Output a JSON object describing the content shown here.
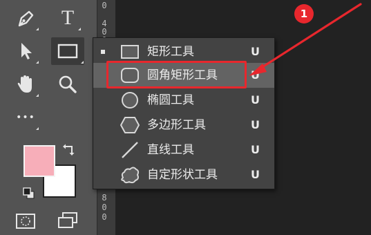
{
  "app": "photoshop",
  "toolbar": {
    "tools": [
      {
        "name": "pen-icon"
      },
      {
        "name": "type-icon",
        "glyph": "T"
      },
      {
        "name": "move-arrow-icon"
      },
      {
        "name": "rectangle-tool-icon",
        "selected": true
      },
      {
        "name": "hand-icon"
      },
      {
        "name": "zoom-icon"
      },
      {
        "name": "more-tools-icon",
        "glyph": "•••"
      }
    ],
    "foreground_color": "#f7aeb9",
    "background_color": "#ffffff"
  },
  "ruler": {
    "top_numbers": [
      "0",
      "4",
      "0",
      "0"
    ],
    "bottom_numbers": [
      "8",
      "0",
      "0"
    ]
  },
  "flyout": {
    "items": [
      {
        "label": "矩形工具",
        "shortcut": "U",
        "icon": "rectangle-icon",
        "active": true
      },
      {
        "label": "圆角矩形工具",
        "shortcut": "U",
        "icon": "rounded-rectangle-icon",
        "hover": true
      },
      {
        "label": "椭圆工具",
        "shortcut": "U",
        "icon": "ellipse-icon"
      },
      {
        "label": "多边形工具",
        "shortcut": "U",
        "icon": "polygon-icon"
      },
      {
        "label": "直线工具",
        "shortcut": "U",
        "icon": "line-icon"
      },
      {
        "label": "自定形状工具",
        "shortcut": "U",
        "icon": "custom-shape-icon"
      }
    ]
  },
  "annotation": {
    "badge_number": "1",
    "accent_color": "#e8272d"
  }
}
